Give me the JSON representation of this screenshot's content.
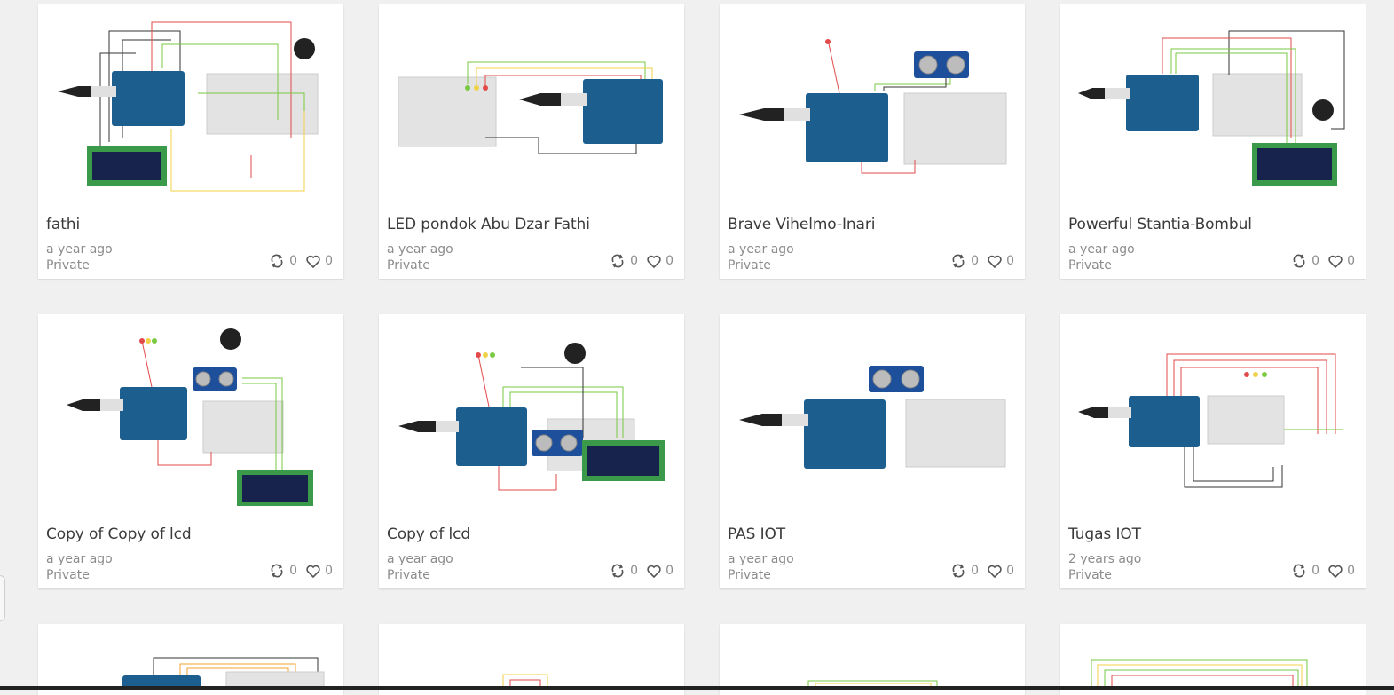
{
  "projects": [
    {
      "title": "fathi",
      "time": "a year ago",
      "visibility": "Private",
      "remixes": "0",
      "likes": "0"
    },
    {
      "title": "LED pondok Abu Dzar Fathi",
      "time": "a year ago",
      "visibility": "Private",
      "remixes": "0",
      "likes": "0"
    },
    {
      "title": "Brave Vihelmo-Inari",
      "time": "a year ago",
      "visibility": "Private",
      "remixes": "0",
      "likes": "0"
    },
    {
      "title": "Powerful Stantia-Bombul",
      "time": "a year ago",
      "visibility": "Private",
      "remixes": "0",
      "likes": "0"
    },
    {
      "title": "Copy of Copy of lcd",
      "time": "a year ago",
      "visibility": "Private",
      "remixes": "0",
      "likes": "0"
    },
    {
      "title": "Copy of lcd",
      "time": "a year ago",
      "visibility": "Private",
      "remixes": "0",
      "likes": "0"
    },
    {
      "title": "PAS IOT",
      "time": "a year ago",
      "visibility": "Private",
      "remixes": "0",
      "likes": "0"
    },
    {
      "title": "Tugas IOT",
      "time": "2 years ago",
      "visibility": "Private",
      "remixes": "0",
      "likes": "0"
    }
  ],
  "icons": {
    "remix": "remix-icon",
    "like": "heart-icon"
  },
  "colors": {
    "background": "#f0f0f0",
    "card": "#ffffff",
    "title": "#3a3a3a",
    "meta": "#8c8c8c",
    "arduino": "#1c5f8f"
  }
}
